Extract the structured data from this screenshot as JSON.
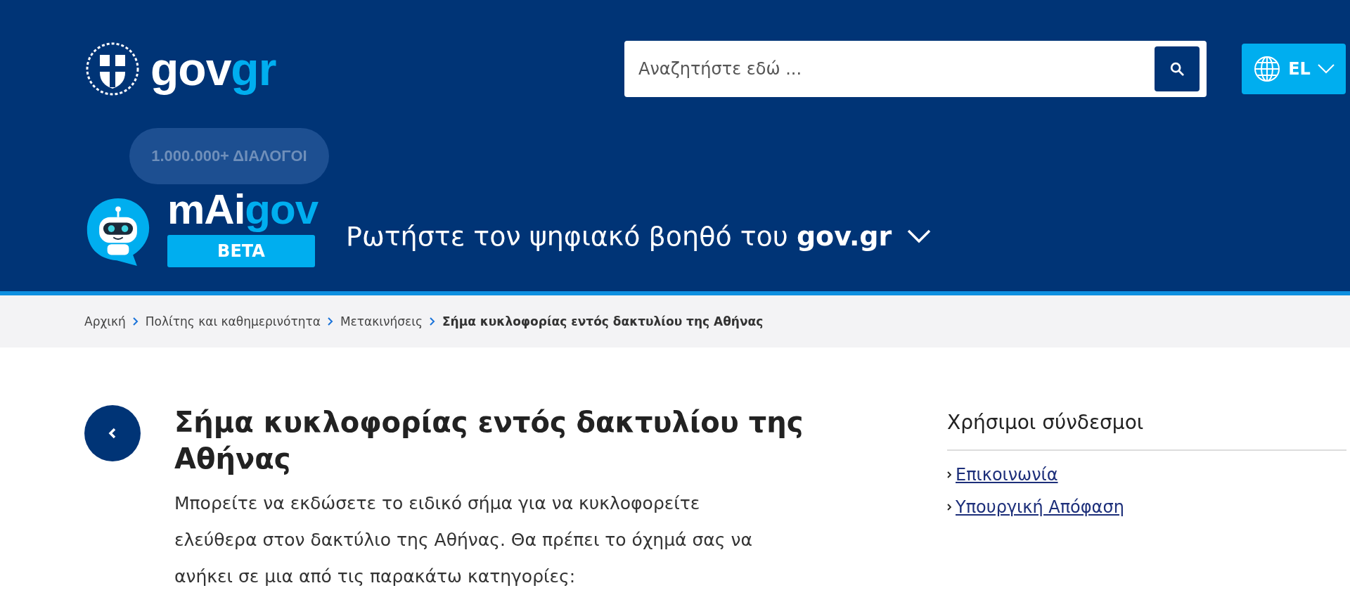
{
  "header": {
    "logo": {
      "parts": [
        {
          "text": "gov",
          "kind": "plain"
        },
        {
          "text": "gr",
          "kind": "accent"
        }
      ]
    },
    "search": {
      "placeholder": "Αναζητήστε εδώ ..."
    },
    "language": {
      "label": "EL"
    }
  },
  "assistant": {
    "badge": "1.000.000+ ΔΙΑΛΟΓΟΙ",
    "name_parts": [
      {
        "text": "mAi",
        "kind": "plain"
      },
      {
        "text": "gov",
        "kind": "accent"
      }
    ],
    "tag": "BETA",
    "prompt": "Ρωτήστε τον ψηφιακό βοηθό του **gov.gr**",
    "expanded": false
  },
  "breadcrumb": [
    {
      "label": "Αρχική",
      "current": false
    },
    {
      "label": "Πολίτης και καθημερινότητα",
      "current": false
    },
    {
      "label": "Μετακινήσεις",
      "current": false
    },
    {
      "label": "Σήμα κυκλοφορίας εντός δακτυλίου της Αθήνας",
      "current": true
    }
  ],
  "article": {
    "title": "Σήμα κυκλοφορίας εντός δακτυλίου της Αθήνας",
    "intro": "Μπορείτε να εκδώσετε το ειδικό σήμα για να κυκλοφορείτε ελεύθερα στον δακτύλιο της Αθήνας. Θα πρέπει το όχημά σας να ανήκει σε μια από τις παρακάτω κατηγορίες:"
  },
  "sidebar": {
    "title": "Χρήσιμοι σύνδεσμοι",
    "links": [
      "Επικοινωνία",
      "Υπουργική Απόφαση"
    ]
  }
}
